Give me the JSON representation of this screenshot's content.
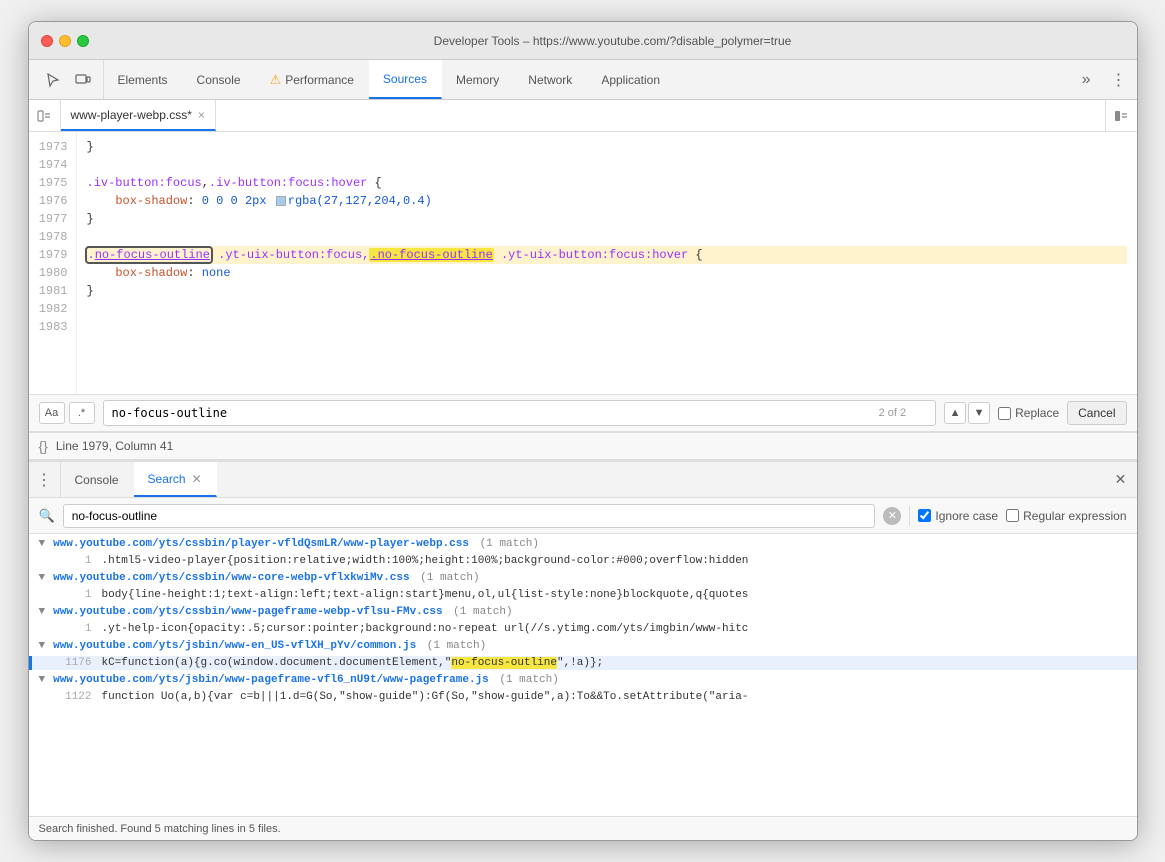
{
  "window": {
    "title": "Developer Tools – https://www.youtube.com/?disable_polymer=true",
    "traffic_lights": [
      "close",
      "minimize",
      "maximize"
    ]
  },
  "tabs": {
    "items": [
      {
        "id": "elements",
        "label": "Elements",
        "active": false,
        "warning": false
      },
      {
        "id": "console",
        "label": "Console",
        "active": false,
        "warning": false
      },
      {
        "id": "performance",
        "label": "Performance",
        "active": false,
        "warning": true
      },
      {
        "id": "sources",
        "label": "Sources",
        "active": true,
        "warning": false
      },
      {
        "id": "memory",
        "label": "Memory",
        "active": false,
        "warning": false
      },
      {
        "id": "network",
        "label": "Network",
        "active": false,
        "warning": false
      },
      {
        "id": "application",
        "label": "Application",
        "active": false,
        "warning": false
      }
    ],
    "more_label": "»"
  },
  "file_tab": {
    "filename": "www-player-webp.css",
    "modified": true,
    "close_label": "×"
  },
  "code": {
    "lines": [
      {
        "num": "1973",
        "content": "}",
        "highlight": false
      },
      {
        "num": "1974",
        "content": "",
        "highlight": false
      },
      {
        "num": "1975",
        "content": ".iv-button:focus,.iv-button:focus:hover {",
        "highlight": false
      },
      {
        "num": "1976",
        "content": "    box-shadow: 0 0 0 2px  rgba(27,127,204,0.4)",
        "highlight": false
      },
      {
        "num": "1977",
        "content": "}",
        "highlight": false
      },
      {
        "num": "1978",
        "content": "",
        "highlight": false
      },
      {
        "num": "1979",
        "content": ".no-focus-outline .yt-uix-button:focus,.no-focus-outline .yt-uix-button:focus:hover {",
        "highlight": true
      },
      {
        "num": "1980",
        "content": "    box-shadow: none",
        "highlight": false
      },
      {
        "num": "1981",
        "content": "}",
        "highlight": false
      },
      {
        "num": "1982",
        "content": "",
        "highlight": false
      },
      {
        "num": "1983",
        "content": "",
        "highlight": false
      }
    ]
  },
  "find_bar": {
    "search_value": "no-focus-outline",
    "count": "2 of 2",
    "match_case_label": "Aa",
    "regex_label": ".*",
    "replace_label": "Replace",
    "cancel_label": "Cancel",
    "up_arrow": "▲",
    "down_arrow": "▼"
  },
  "status_bar": {
    "icon_label": "{}",
    "text": "Line 1979, Column 41"
  },
  "panel": {
    "menu_icon": "⋮",
    "tabs": [
      {
        "id": "console",
        "label": "Console",
        "active": false,
        "closeable": false
      },
      {
        "id": "search",
        "label": "Search",
        "active": true,
        "closeable": true
      }
    ],
    "close_label": "✕"
  },
  "search_panel": {
    "icon": "🔍",
    "input_value": "no-focus-outline",
    "clear_label": "✕",
    "ignore_case_checked": true,
    "ignore_case_label": "Ignore case",
    "regex_checked": false,
    "regex_label": "Regular expression"
  },
  "search_results": {
    "files": [
      {
        "url": "www.youtube.com/yts/cssbin/player-vfldQsmLR/www-player-webp.css",
        "match_count": "(1 match)",
        "rows": [
          {
            "line": "1",
            "code": ".html5-video-player{position:relative;width:100%;height:100%;background-color:#000;overflow:hidden",
            "selected": false
          }
        ]
      },
      {
        "url": "www.youtube.com/yts/cssbin/www-core-webp-vflxkwiMv.css",
        "match_count": "(1 match)",
        "rows": [
          {
            "line": "1",
            "code": "body{line-height:1;text-align:left;text-align:start}menu,ol,ul{list-style:none}blockquote,q{quotes",
            "selected": false
          }
        ]
      },
      {
        "url": "www.youtube.com/yts/cssbin/www-pageframe-webp-vflsu-FMv.css",
        "match_count": "(1 match)",
        "rows": [
          {
            "line": "1",
            "code": ".yt-help-icon{opacity:.5;cursor:pointer;background:no-repeat url(//s.ytimg.com/yts/imgbin/www-hitc",
            "selected": false
          }
        ]
      },
      {
        "url": "www.youtube.com/yts/jsbin/www-en_US-vflXH_pYv/common.js",
        "match_count": "(1 match)",
        "rows": [
          {
            "line": "1176",
            "code_before": "kC=function(a){g.co(window.document.documentElement,\"",
            "code_highlight": "no-focus-outline",
            "code_after": "\",!a)};",
            "selected": true
          }
        ]
      },
      {
        "url": "www.youtube.com/yts/jsbin/www-pageframe-vfl6_nU9t/www-pageframe.js",
        "match_count": "(1 match)",
        "rows": [
          {
            "line": "1122",
            "code": "function Uo(a,b){var c=b|||1.d=G(So,\"show-guide\"):Gf(So,\"show-guide\",a):To&&To.setAttribute(\"aria-",
            "selected": false
          }
        ]
      }
    ],
    "status": "Search finished.  Found 5 matching lines in 5 files."
  }
}
